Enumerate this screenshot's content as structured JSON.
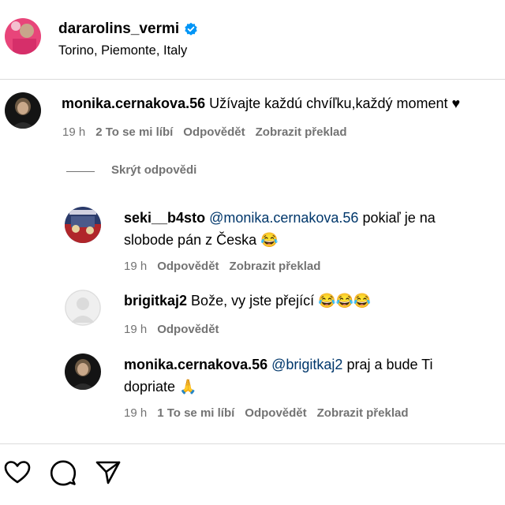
{
  "post": {
    "username": "dararolins_vermi",
    "location": "Torino, Piemonte, Italy",
    "verified_icon": "verified-badge-icon"
  },
  "comment": {
    "username": "monika.cernakova.56",
    "text": "Užívajte každú chvíľku,každý moment ♥",
    "time": "19 h",
    "likes": "2 To se mi líbí",
    "reply": "Odpovědět",
    "translate": "Zobrazit překlad",
    "hide_replies": "Skrýt odpovědi"
  },
  "replies": [
    {
      "username": "seki__b4sto",
      "mention": "@monika.cernakova.56",
      "text_line1": " pokiaľ je na",
      "text_line2": "slobode pán z Česka 😂",
      "time": "19 h",
      "reply": "Odpovědět",
      "translate": "Zobrazit překlad"
    },
    {
      "username": "brigitkaj2",
      "text": "Bože, vy jste přející 😂😂😂",
      "time": "19 h",
      "reply": "Odpovědět"
    },
    {
      "username": "monika.cernakova.56",
      "mention": "@brigitkaj2",
      "text_line1": " praj a bude Ti",
      "text_line2": "dopriate 🙏",
      "time": "19 h",
      "likes": "1 To se mi líbí",
      "reply": "Odpovědět",
      "translate": "Zobrazit překlad"
    }
  ],
  "icons": {
    "like": "heart-icon",
    "comment": "comment-bubble-icon",
    "share": "send-icon"
  },
  "colors": {
    "verified": "#0095f6",
    "meta": "#737373",
    "mention": "#00376b",
    "divider": "#dbdbdb"
  }
}
